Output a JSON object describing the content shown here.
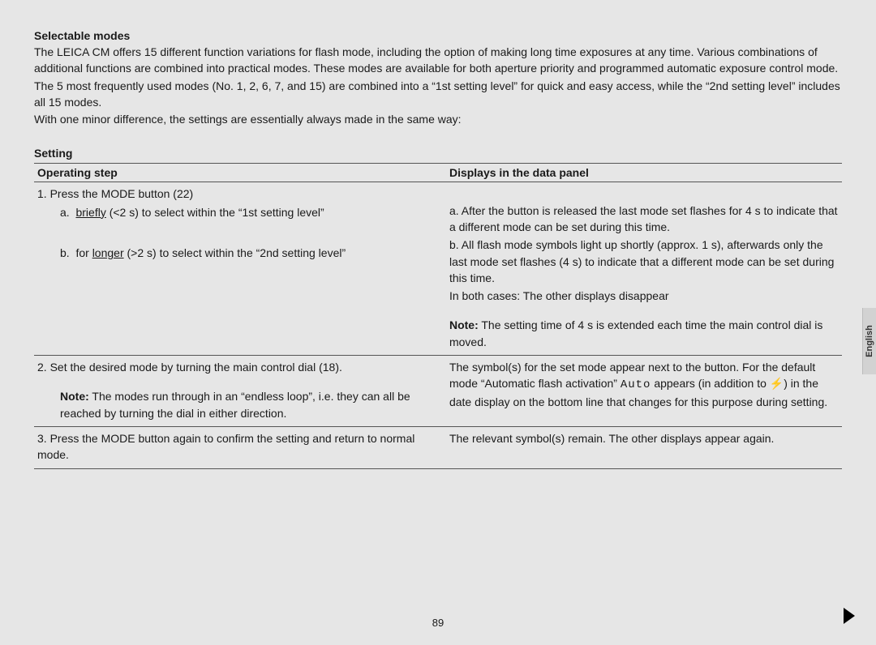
{
  "title": "Selectable modes",
  "intro": {
    "p1": "The LEICA CM offers 15 different function variations for flash mode, including the option of making long time exposures at any time. Various combinations of additional functions are combined into practical modes. These modes are available for both aperture priority and programmed automatic exposure control mode.",
    "p2": "The 5 most frequently used modes (No. 1, 2, 6, 7, and 15) are combined into a “1st setting level” for quick and easy access, while the “2nd setting level” includes all 15 modes.",
    "p3": "With one minor difference, the settings are essentially always made in the same way:"
  },
  "setting_label": "Setting",
  "table": {
    "col1": "Operating step",
    "col2": "Displays in the data panel",
    "row1": {
      "step_head": "1. Press the MODE button (22)",
      "step_a_prefix": "a.  ",
      "step_a_word": "briefly",
      "step_a_rest": " (<2 s) to select within the “1st setting level”",
      "step_b_prefix": "b.  for ",
      "step_b_word": "longer",
      "step_b_rest": " (>2 s) to select within the “2nd setting level”",
      "disp_a": "a. After the button is released the last mode set flashes for 4 s to indicate that a different mode can be set during this time.",
      "disp_b": "b. All flash mode symbols light up shortly (approx. 1 s), afterwards only the last mode set flashes (4 s) to indicate that a different mode can be set during this time.",
      "disp_both": "In both cases: The other displays disappear",
      "note_label": "Note:",
      "note_text": " The setting time of 4 s is extended each time the main control dial is moved."
    },
    "row2": {
      "step": "2. Set the desired mode by turning the main control dial (18).",
      "note_label": "Note:",
      "note_text": " The modes run through in an “endless loop”, i.e. they can all be reached by turning the dial in either direction.",
      "disp_a": "The symbol(s) for the set mode appear next to the button. For the default mode “Automatic flash activation” ",
      "disp_auto": "Auto",
      "disp_b": " appears (in addition to ",
      "disp_flash": "⚡",
      "disp_c": ") in the date display on the bottom line that changes for this purpose during setting."
    },
    "row3": {
      "step": "3. Press the MODE button again to confirm the setting and return to normal mode.",
      "disp": "The relevant symbol(s) remain. The other displays appear again."
    }
  },
  "page_number": "89",
  "side_tab": "English"
}
